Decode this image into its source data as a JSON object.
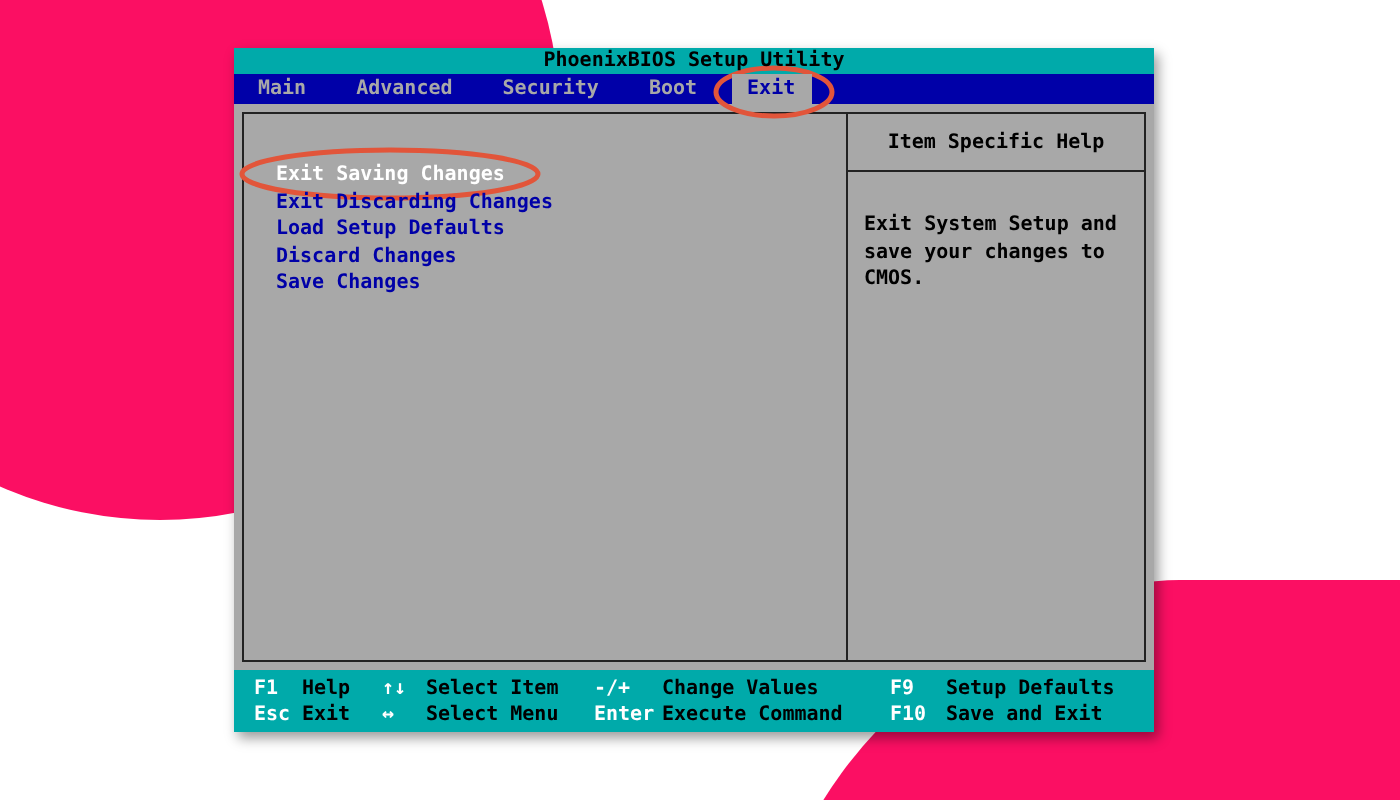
{
  "window": {
    "title": "PhoenixBIOS Setup Utility"
  },
  "tabs": [
    {
      "label": "Main",
      "selected": false
    },
    {
      "label": "Advanced",
      "selected": false
    },
    {
      "label": "Security",
      "selected": false
    },
    {
      "label": "Boot",
      "selected": false
    },
    {
      "label": "Exit",
      "selected": true
    }
  ],
  "menu": {
    "items": [
      {
        "label": "Exit Saving Changes",
        "selected": true
      },
      {
        "label": "Exit Discarding Changes",
        "selected": false
      },
      {
        "label": "Load Setup Defaults",
        "selected": false
      },
      {
        "label": "Discard Changes",
        "selected": false
      },
      {
        "label": "Save Changes",
        "selected": false
      }
    ]
  },
  "help": {
    "title": "Item Specific Help",
    "text": "Exit System Setup and save your changes to CMOS."
  },
  "status_bar": {
    "rows": [
      [
        {
          "key": "F1",
          "action": "Help"
        },
        {
          "key": "↑↓",
          "action": "Select Item"
        },
        {
          "key": "-/+",
          "action": "Change Values"
        },
        {
          "key": "F9",
          "action": "Setup Defaults"
        }
      ],
      [
        {
          "key": "Esc",
          "action": "Exit"
        },
        {
          "key": "↔",
          "action": "Select Menu"
        },
        {
          "key": "Enter",
          "action": "Execute Command"
        },
        {
          "key": "F10",
          "action": "Save and Exit"
        }
      ]
    ]
  }
}
